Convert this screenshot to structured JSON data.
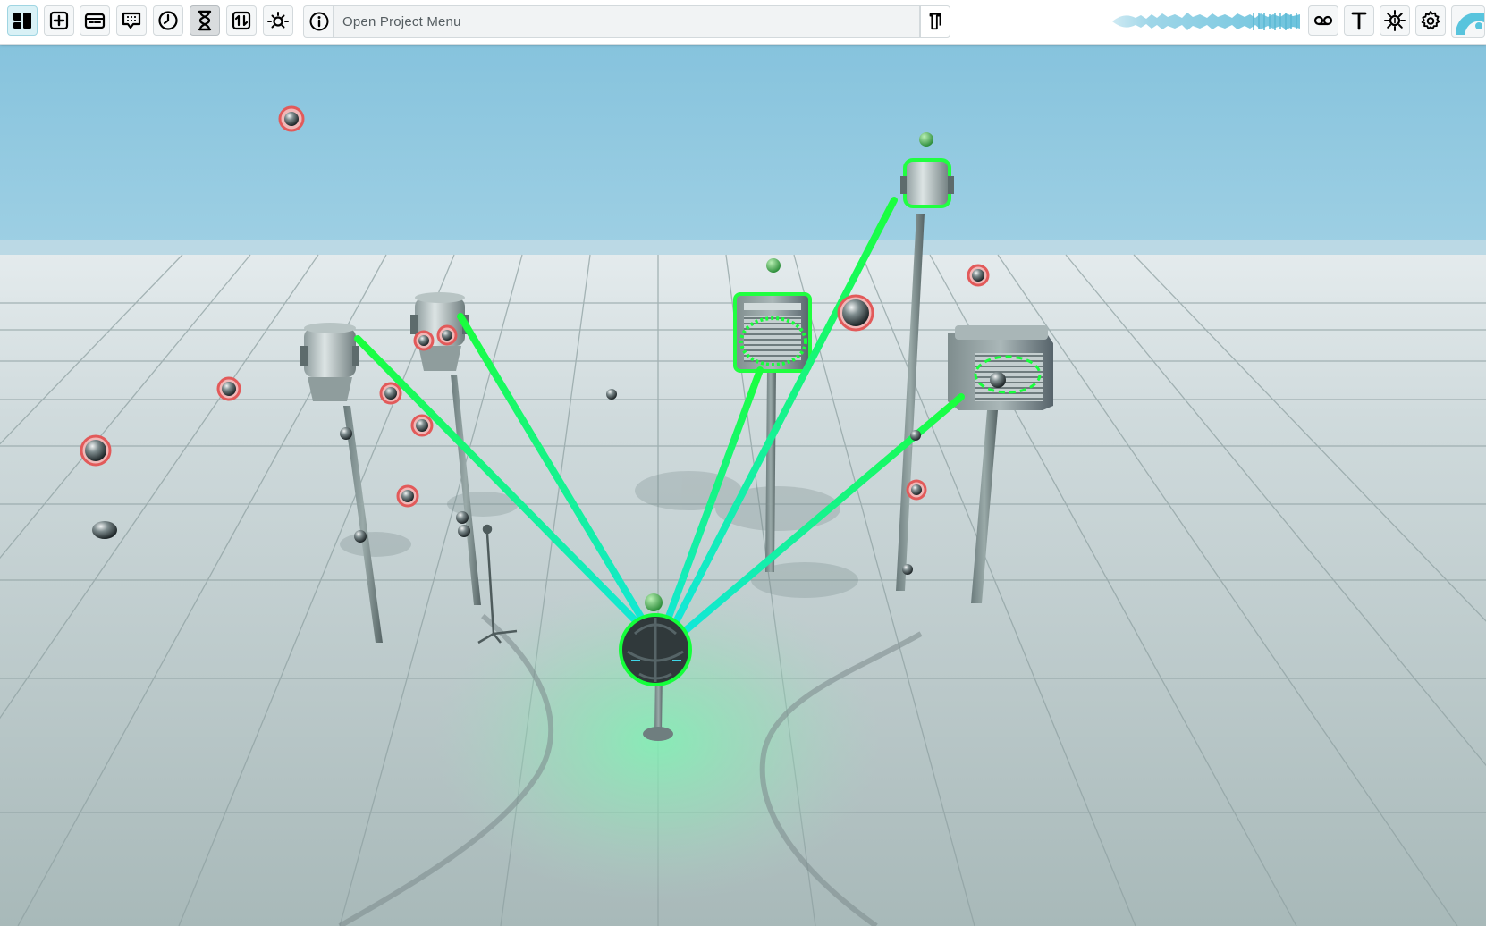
{
  "toolbar": {
    "buttons": [
      {
        "id": "layout",
        "icon": "layout-grid-icon",
        "active": true
      },
      {
        "id": "add",
        "icon": "plus-square-icon"
      },
      {
        "id": "panel",
        "icon": "panel-icon"
      },
      {
        "id": "speech",
        "icon": "speech-bubble-icon"
      },
      {
        "id": "clock",
        "icon": "clock-icon"
      },
      {
        "id": "hourglass",
        "icon": "hourglass-icon",
        "pressed": true
      },
      {
        "id": "sort",
        "icon": "sort-arrows-icon"
      },
      {
        "id": "brightness",
        "icon": "brightness-icon"
      }
    ],
    "project_menu_label": "Open Project Menu",
    "right_buttons": [
      {
        "id": "voicemail",
        "icon": "voicemail-icon"
      },
      {
        "id": "text",
        "icon": "text-icon",
        "label": "T"
      },
      {
        "id": "sun",
        "icon": "sun-icon"
      },
      {
        "id": "settings",
        "icon": "gear-icon"
      }
    ],
    "accent_color": "#52c3dd"
  },
  "scene": {
    "sky_color": "#8ec6de",
    "floor_color": "#b9c9cc",
    "selection_color": "#00ff40",
    "link_color": "#00e5d0",
    "object_marker_color": "#e85a5a"
  }
}
